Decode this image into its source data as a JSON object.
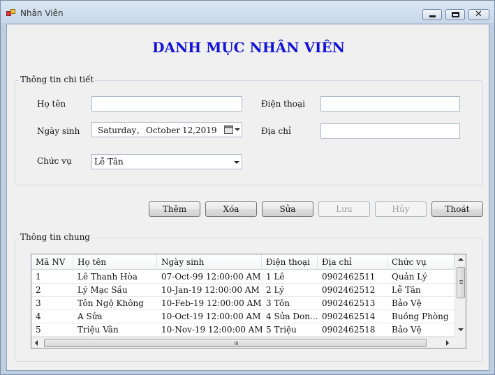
{
  "window": {
    "title": "Nhân Viên",
    "close_glyph": "✕"
  },
  "form": {
    "heading": "DANH MỤC NHÂN VIÊN",
    "detail_group": {
      "legend": "Thông tin chi tiết",
      "name_label": "Họ tên",
      "name_value": "",
      "dob_label": "Ngày sinh",
      "dob": {
        "weekday": "Saturday",
        "sep": ",",
        "month": "October",
        "daynum": "12,",
        "year": "2019"
      },
      "position_label": "Chức vụ",
      "position_selected": "Lễ Tân",
      "phone_label": "Điện thoại",
      "phone_value": "",
      "address_label": "Địa chỉ",
      "address_value": ""
    },
    "buttons": {
      "add": "Thêm",
      "delete": "Xóa",
      "edit": "Sửa",
      "save": "Lưu",
      "cancel": "Hủy",
      "exit": "Thoát"
    },
    "general_group": {
      "legend": "Thông tin chung"
    }
  },
  "grid": {
    "columns": [
      "Mã NV",
      "Họ tên",
      "Ngày sinh",
      "Điện thoại",
      "Địa chỉ",
      "Chức vụ"
    ],
    "rows": [
      [
        "1",
        "Lê Thanh Hòa",
        "07-Oct-99 12:00:00 AM",
        "1 Lê",
        "0902462511",
        "Quản Lý"
      ],
      [
        "2",
        "Lý Mạc Sầu",
        "10-Jan-19 12:00:00 AM",
        "2 Lý",
        "0902462512",
        "Lễ Tân"
      ],
      [
        "3",
        "Tôn Ngộ Không",
        "10-Feb-19 12:00:00 AM",
        "3 Tôn",
        "0902462513",
        "Bảo Vệ"
      ],
      [
        "4",
        "A Sửa",
        "10-Oct-19 12:00:00 AM",
        "4 Sửa Don...",
        "0902462514",
        "Buồng Phòng"
      ],
      [
        "5",
        "Triệu Vân",
        "10-Nov-19 12:00:00 AM",
        "5 Triệu",
        "0902462518",
        "Bảo Vệ"
      ]
    ]
  },
  "icons": {
    "app": "app-icon",
    "calendar": "calendar-icon",
    "dropdown": "chevron-down-icon"
  }
}
